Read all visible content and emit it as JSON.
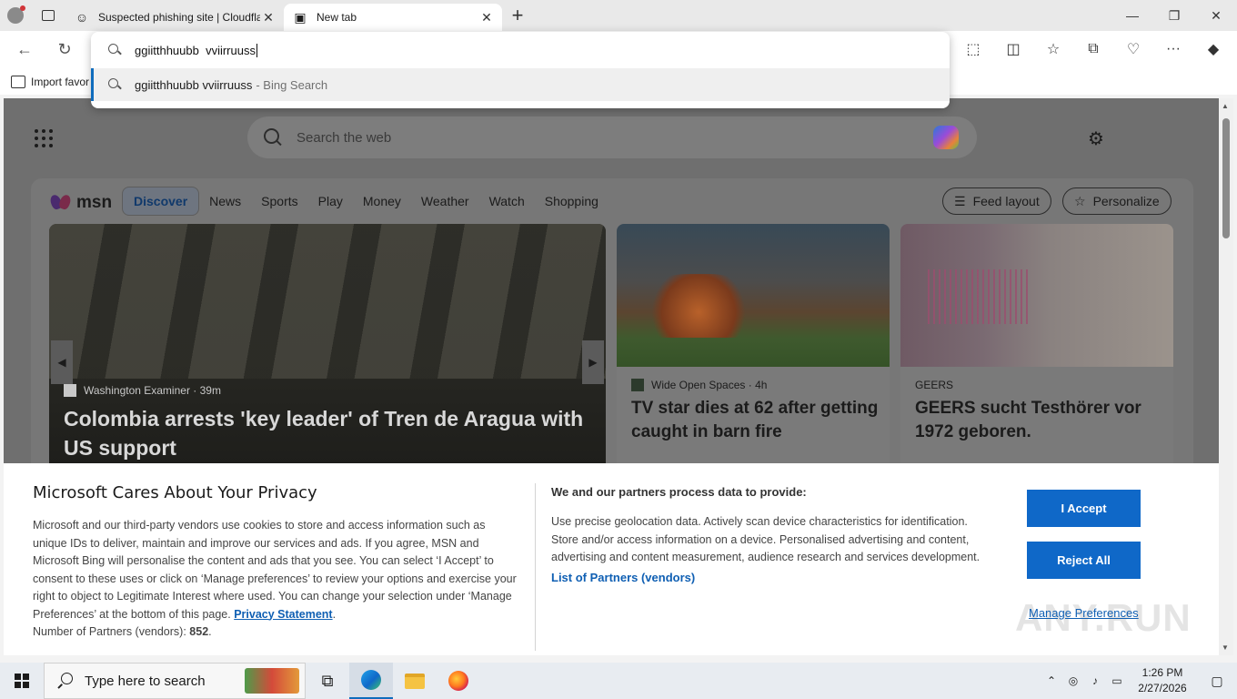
{
  "browser": {
    "tabs": [
      {
        "title": "Suspected phishing site | Cloudfla",
        "icon": "smiley-icon",
        "active": false
      },
      {
        "title": "New tab",
        "icon": "newtab-icon",
        "active": true
      }
    ],
    "favorites_bar": {
      "import_label": "Import favor"
    }
  },
  "omnibox": {
    "typed": "ggiitthhuubb  vviirruuss",
    "suggestion_query": "ggiitthhuubb vviirruuss",
    "suggestion_suffix": "- Bing Search"
  },
  "newtab": {
    "search_placeholder": "Search the web",
    "msn": {
      "logo_text": "msn",
      "nav": [
        "Discover",
        "News",
        "Sports",
        "Play",
        "Money",
        "Weather",
        "Watch",
        "Shopping"
      ],
      "active_nav": "Discover",
      "feed_layout_label": "Feed layout",
      "personalize_label": "Personalize"
    },
    "hero": {
      "source": "Washington Examiner",
      "age": "· 39m",
      "headline": "Colombia arrests 'key leader' of Tren de Aragua with US support"
    },
    "cards": [
      {
        "source": "Wide Open Spaces",
        "age": "· 4h",
        "headline": "TV star dies at 62 after getting caught in barn fire"
      },
      {
        "source": "GEERS",
        "age": "",
        "headline": "GEERS sucht Testhörer vor 1972 geboren."
      }
    ]
  },
  "privacy": {
    "title": "Microsoft Cares About Your Privacy",
    "body": "Microsoft and our third-party vendors use cookies to store and access information such as unique IDs to deliver, maintain and improve our services and ads. If you agree, MSN and Microsoft Bing will personalise the content and ads that you see. You can select ‘I Accept’ to consent to these uses or click on ‘Manage preferences’ to review your options and exercise your right to object to Legitimate Interest where used.  You can change your selection under ‘Manage Preferences’ at the bottom of this page.",
    "privacy_link": "Privacy Statement",
    "partners_prefix": "Number of Partners (vendors):",
    "partners_count": "852",
    "purposes_title": "We and our partners process data to provide:",
    "purposes_text": "Use precise geolocation data. Actively scan device characteristics for identification. Store and/or access information on a device. Personalised advertising and content, advertising and content measurement, audience research and services development.",
    "partners_link": "List of Partners (vendors)",
    "accept_label": "I Accept",
    "reject_label": "Reject All",
    "manage_label": "Manage Preferences"
  },
  "watermark": "ANY.RUN",
  "taskbar": {
    "search_placeholder": "Type here to search",
    "time": "1:26 PM",
    "date": "2/27/2026"
  }
}
